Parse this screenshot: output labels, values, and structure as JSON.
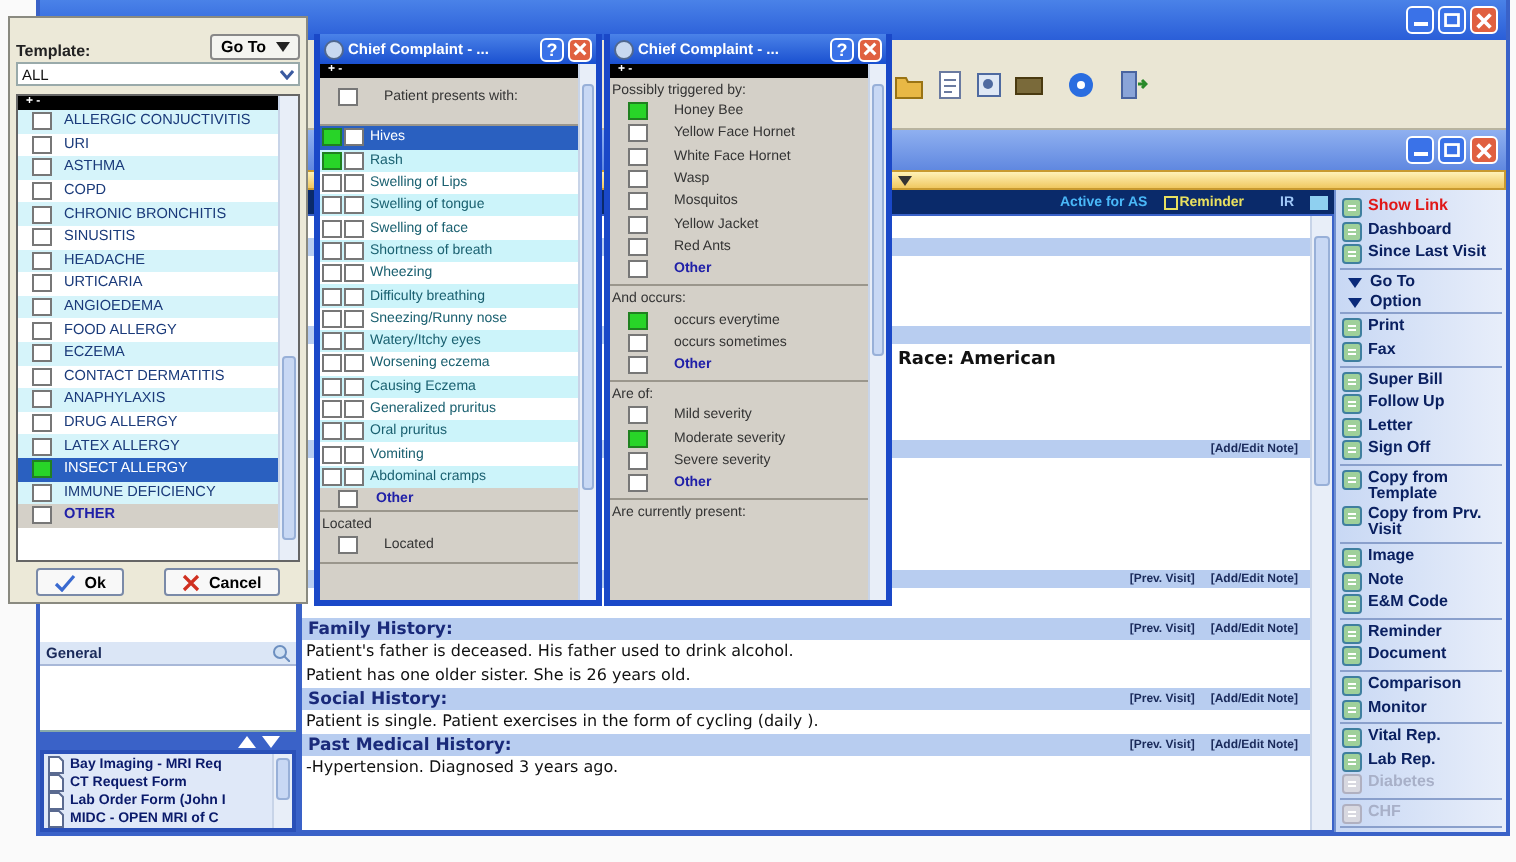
{
  "template_panel": {
    "label": "Template:",
    "goto_button": "Go To",
    "filter": "ALL",
    "header": "+ -",
    "items": [
      {
        "label": "ALLERGIC CONJUCTIVITIS",
        "kind": "item",
        "checked": false,
        "selected": false
      },
      {
        "label": "URI",
        "kind": "item",
        "checked": false,
        "selected": false
      },
      {
        "label": "ASTHMA",
        "kind": "item",
        "checked": false,
        "selected": false
      },
      {
        "label": "COPD",
        "kind": "item",
        "checked": false,
        "selected": false
      },
      {
        "label": "CHRONIC BRONCHITIS",
        "kind": "item",
        "checked": false,
        "selected": false
      },
      {
        "label": "SINUSITIS",
        "kind": "item",
        "checked": false,
        "selected": false
      },
      {
        "label": "HEADACHE",
        "kind": "item",
        "checked": false,
        "selected": false
      },
      {
        "label": "URTICARIA",
        "kind": "item",
        "checked": false,
        "selected": false
      },
      {
        "label": "ANGIOEDEMA",
        "kind": "item",
        "checked": false,
        "selected": false
      },
      {
        "label": "FOOD ALLERGY",
        "kind": "item",
        "checked": false,
        "selected": false
      },
      {
        "label": "ECZEMA",
        "kind": "item",
        "checked": false,
        "selected": false
      },
      {
        "label": "CONTACT DERMATITIS",
        "kind": "item",
        "checked": false,
        "selected": false
      },
      {
        "label": "ANAPHYLAXIS",
        "kind": "item",
        "checked": false,
        "selected": false
      },
      {
        "label": "DRUG ALLERGY",
        "kind": "item",
        "checked": false,
        "selected": false
      },
      {
        "label": "LATEX ALLERGY",
        "kind": "item",
        "checked": false,
        "selected": false
      },
      {
        "label": "INSECT ALLERGY",
        "kind": "item",
        "checked": true,
        "selected": true
      },
      {
        "label": "IMMUNE DEFICIENCY",
        "kind": "item",
        "checked": false,
        "selected": false
      },
      {
        "label": "OTHER",
        "kind": "other",
        "checked": false,
        "selected": false
      }
    ],
    "buttons": [
      {
        "label": "Ok",
        "kind": "ok"
      },
      {
        "label": "Cancel",
        "kind": "cancel"
      }
    ]
  },
  "complaint_popups": [
    {
      "title": "Chief Complaint - ...",
      "help_button": "?",
      "header": "+ -",
      "sections": [
        {
          "kind": "intro",
          "items": [
            {
              "label": "Patient presents with:",
              "kind": "single",
              "checked": false
            }
          ]
        },
        {
          "kind": "list",
          "items": [
            {
              "label": "Hives",
              "kind": "double",
              "checked": true,
              "selected": true
            },
            {
              "label": "Rash",
              "kind": "double",
              "checked": true,
              "selected": false
            },
            {
              "label": "Swelling of Lips",
              "kind": "double",
              "checked": false,
              "selected": false
            },
            {
              "label": "Swelling of tongue",
              "kind": "double",
              "checked": false,
              "selected": false
            },
            {
              "label": "Swelling of face",
              "kind": "double",
              "checked": false,
              "selected": false
            },
            {
              "label": "Shortness of breath",
              "kind": "double",
              "checked": false,
              "selected": false
            },
            {
              "label": "Wheezing",
              "kind": "double",
              "checked": false,
              "selected": false
            },
            {
              "label": "Difficulty breathing",
              "kind": "double",
              "checked": false,
              "selected": false
            },
            {
              "label": "Sneezing/Runny nose",
              "kind": "double",
              "checked": false,
              "selected": false
            },
            {
              "label": "Watery/Itchy eyes",
              "kind": "double",
              "checked": false,
              "selected": false
            },
            {
              "label": "Worsening eczema",
              "kind": "double",
              "checked": false,
              "selected": false
            },
            {
              "label": "Causing Eczema",
              "kind": "double",
              "checked": false,
              "selected": false
            },
            {
              "label": "Generalized pruritus",
              "kind": "double",
              "checked": false,
              "selected": false
            },
            {
              "label": "Oral pruritus",
              "kind": "double",
              "checked": false,
              "selected": false
            },
            {
              "label": "Vomiting",
              "kind": "double",
              "checked": false,
              "selected": false
            },
            {
              "label": "Abdominal cramps",
              "kind": "double",
              "checked": false,
              "selected": false
            },
            {
              "label": "Other",
              "kind": "other",
              "checked": false,
              "selected": false
            }
          ]
        },
        {
          "kind": "group",
          "heading": "Located",
          "items": [
            {
              "label": "Located",
              "kind": "single",
              "checked": false
            }
          ]
        }
      ]
    },
    {
      "title": "Chief Complaint - ...",
      "help_button": "?",
      "header": "+ -",
      "sections": [
        {
          "kind": "group",
          "heading": "Possibly triggered by:",
          "items": [
            {
              "label": "Honey Bee",
              "kind": "single",
              "checked": true
            },
            {
              "label": "Yellow Face Hornet",
              "kind": "single",
              "checked": false
            },
            {
              "label": "White Face Hornet",
              "kind": "single",
              "checked": false
            },
            {
              "label": "Wasp",
              "kind": "single",
              "checked": false
            },
            {
              "label": "Mosquitos",
              "kind": "single",
              "checked": false
            },
            {
              "label": "Yellow Jacket",
              "kind": "single",
              "checked": false
            },
            {
              "label": "Red Ants",
              "kind": "single",
              "checked": false
            },
            {
              "label": "Other",
              "kind": "other",
              "checked": false
            }
          ]
        },
        {
          "kind": "group",
          "heading": "And occurs:",
          "items": [
            {
              "label": "occurs everytime",
              "kind": "single",
              "checked": true
            },
            {
              "label": "occurs sometimes",
              "kind": "single",
              "checked": false
            },
            {
              "label": "Other",
              "kind": "other",
              "checked": false
            }
          ]
        },
        {
          "kind": "group",
          "heading": "Are of:",
          "items": [
            {
              "label": "Mild severity",
              "kind": "single",
              "checked": false
            },
            {
              "label": "Moderate severity",
              "kind": "single",
              "checked": true
            },
            {
              "label": "Severe severity",
              "kind": "single",
              "checked": false
            },
            {
              "label": "Other",
              "kind": "other",
              "checked": false
            }
          ]
        },
        {
          "kind": "group",
          "heading": "Are currently present:"
        }
      ]
    }
  ],
  "left_pane": {
    "list": [
      {
        "label": "General"
      }
    ],
    "documents": [
      "Bay Imaging - MRI Req",
      "CT Request Form",
      "Lab Order Form (John I",
      "MIDC - OPEN MRI of C"
    ]
  },
  "main": {
    "header": {
      "active": "Active for AS",
      "reminder": "Reminder",
      "ir": "IR"
    },
    "sections": [
      {
        "kind": "covered"
      },
      {
        "kind": "covered",
        "lines": [
          "Race: American"
        ]
      },
      {
        "kind": "covered",
        "links": [
          "[Add/Edit Note]"
        ]
      },
      {
        "kind": "covered",
        "links": [
          "[Prev. Visit]",
          "[Add/Edit Note]"
        ]
      },
      {
        "kind": "open",
        "title": "Family History:",
        "links": [
          "[Prev. Visit]",
          "[Add/Edit Note]"
        ],
        "lines": [
          "Patient's father is deceased. His father used to drink alcohol.",
          "Patient has one older sister. She is 26 years old."
        ]
      },
      {
        "kind": "open",
        "title": "Social History:",
        "links": [
          "[Prev. Visit]",
          "[Add/Edit Note]"
        ],
        "lines": [
          "Patient is single. Patient exercises in the form of cycling (daily )."
        ]
      },
      {
        "kind": "open",
        "title": "Past Medical History:",
        "links": [
          "[Prev. Visit]",
          "[Add/Edit Note]"
        ],
        "lines": [
          "-Hypertension. Diagnosed 3 years ago."
        ]
      }
    ]
  },
  "sidebar": {
    "groups": [
      {
        "items": [
          {
            "label": "Show Link",
            "kind": "alert",
            "disabled": false
          },
          {
            "label": "Dashboard",
            "kind": "button",
            "disabled": false
          },
          {
            "label": "Since Last Visit",
            "kind": "button",
            "disabled": false
          }
        ]
      },
      {
        "items": [
          {
            "label": "Go To",
            "kind": "dropdown",
            "disabled": false
          },
          {
            "label": "Option",
            "kind": "dropdown",
            "disabled": false
          }
        ]
      },
      {
        "items": [
          {
            "label": "Print",
            "kind": "button",
            "disabled": false
          },
          {
            "label": "Fax",
            "kind": "button",
            "disabled": false
          }
        ]
      },
      {
        "items": [
          {
            "label": "Super Bill",
            "kind": "button",
            "disabled": false
          },
          {
            "label": "Follow Up",
            "kind": "button",
            "disabled": false
          },
          {
            "label": "Letter",
            "kind": "button",
            "disabled": false
          },
          {
            "label": "Sign Off",
            "kind": "button",
            "disabled": false
          }
        ]
      },
      {
        "items": [
          {
            "label": "Copy from Template",
            "kind": "button",
            "disabled": false
          },
          {
            "label": "Copy from Prv. Visit",
            "kind": "button",
            "disabled": false
          }
        ]
      },
      {
        "items": [
          {
            "label": "Image",
            "kind": "button",
            "disabled": false
          },
          {
            "label": "Note",
            "kind": "button",
            "disabled": false
          },
          {
            "label": "E&M Code",
            "kind": "button",
            "disabled": false
          }
        ]
      },
      {
        "items": [
          {
            "label": "Reminder",
            "kind": "button",
            "disabled": false
          },
          {
            "label": "Document",
            "kind": "button",
            "disabled": false
          }
        ]
      },
      {
        "items": [
          {
            "label": "Comparison",
            "kind": "button",
            "disabled": false
          },
          {
            "label": "Monitor",
            "kind": "button",
            "disabled": false
          }
        ]
      },
      {
        "items": [
          {
            "label": "Vital Rep.",
            "kind": "button",
            "disabled": false
          },
          {
            "label": "Lab Rep.",
            "kind": "button",
            "disabled": false
          },
          {
            "label": "Diabetes",
            "kind": "button",
            "disabled": true
          }
        ]
      },
      {
        "items": [
          {
            "label": "CHF",
            "kind": "button",
            "disabled": true
          }
        ]
      }
    ]
  }
}
